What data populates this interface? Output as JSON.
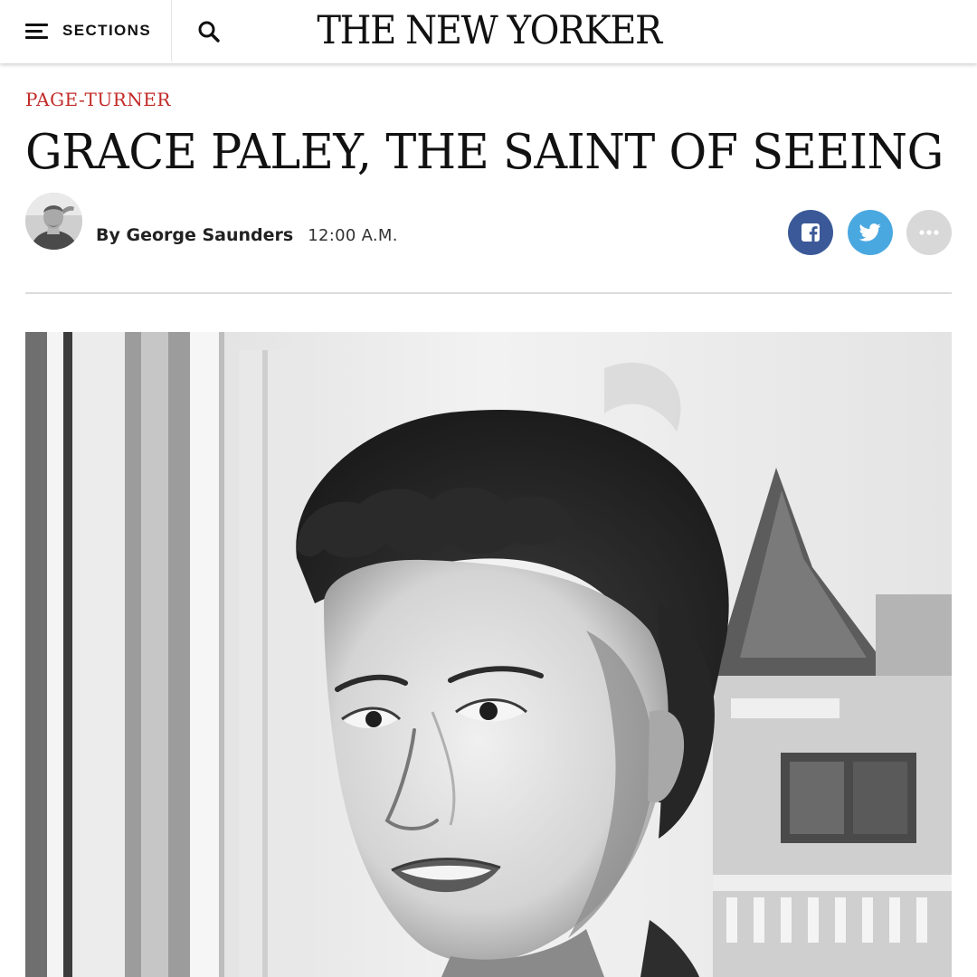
{
  "header": {
    "sections_label": "SECTIONS",
    "logo_text": "THE NEW YORKER",
    "icons": [
      "hamburger-icon",
      "search-icon"
    ]
  },
  "article": {
    "rubric": "PAGE-TURNER",
    "headline": "GRACE PALEY, THE SAINT OF SEEING",
    "byline_author": "By George Saunders",
    "byline_time": "12:00 A.M."
  },
  "share": {
    "items": [
      {
        "name": "facebook",
        "icon": "facebook-icon",
        "color": "#3b5998"
      },
      {
        "name": "twitter",
        "icon": "twitter-icon",
        "color": "#4aa8e0"
      },
      {
        "name": "more",
        "icon": "more-icon",
        "color": "#d8d8d8"
      }
    ]
  },
  "colors": {
    "rubric": "#c22a27",
    "divider": "#dcdcdc"
  }
}
